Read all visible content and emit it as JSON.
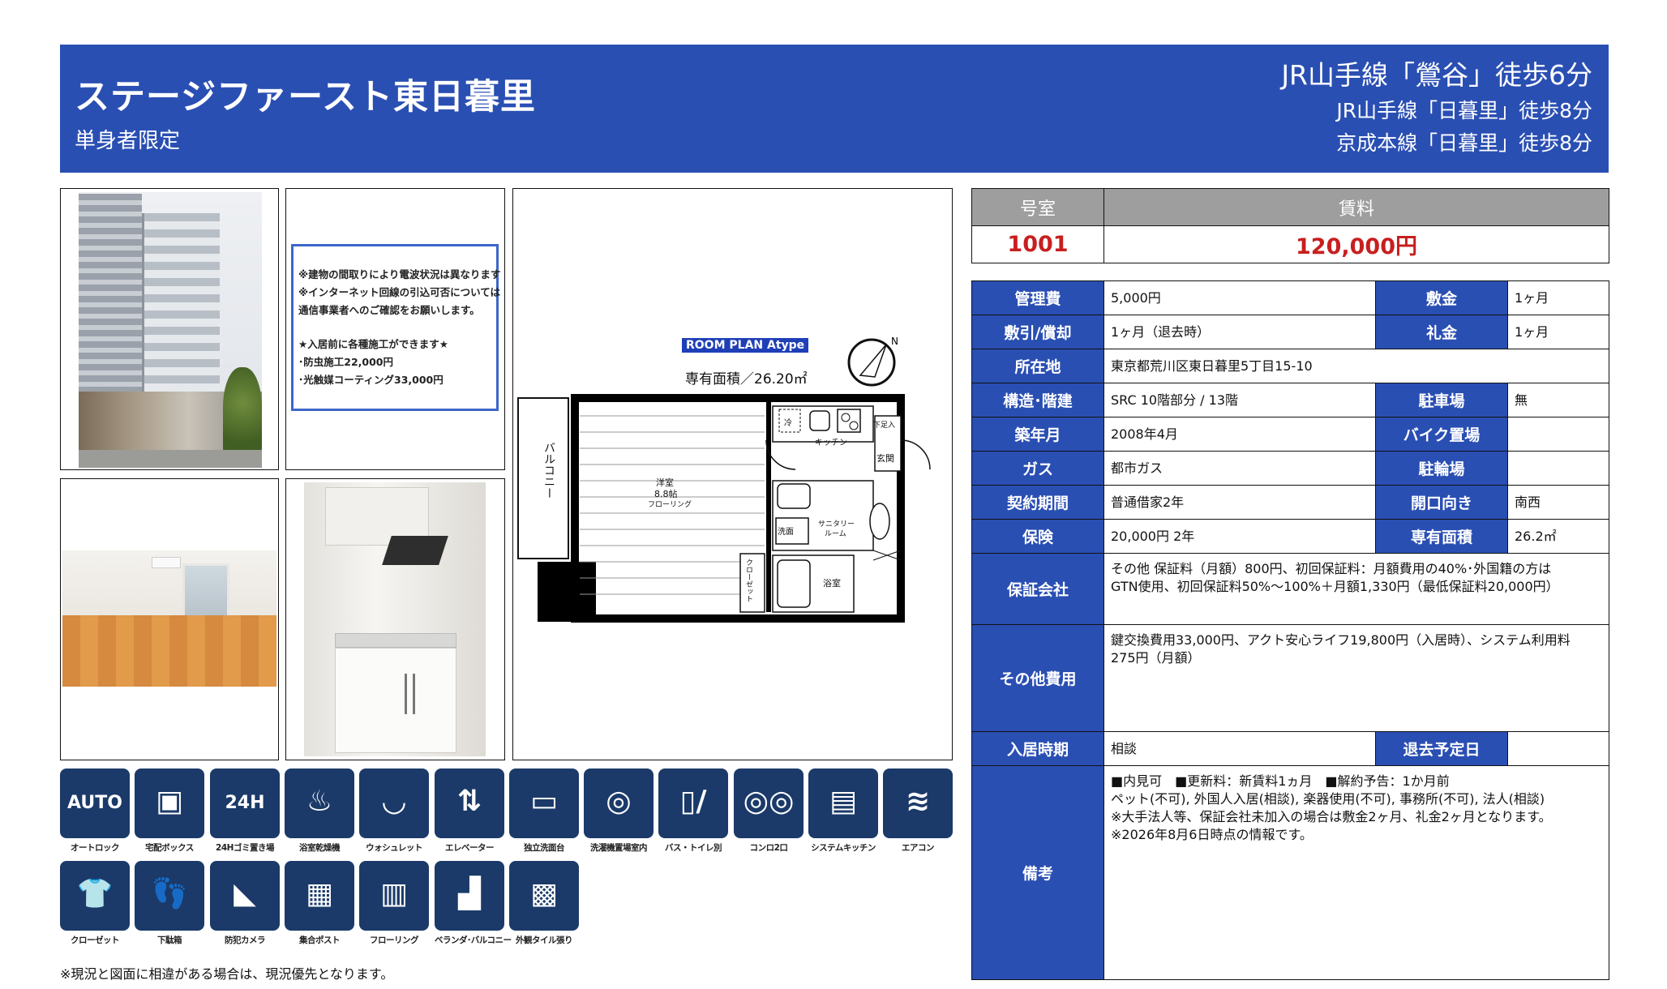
{
  "header": {
    "title": "ステージファースト東日暮里",
    "subtitle": "単身者限定",
    "station_main": "JR山手線「鶯谷」徒歩6分",
    "station_sub1": "JR山手線「日暮里」徒歩8分",
    "station_sub2": "京成本線「日暮里」徒歩8分"
  },
  "notice": {
    "line1": "※建物の間取りにより電波状況は異なります",
    "line2": "※インターネット回線の引込可否については",
    "line3": "通信事業者へのご確認をお願いします。",
    "line4": "★入居前に各種施工ができます★",
    "line5": "･防虫施工22,000円",
    "line6": "･光触媒コーティング33,000円"
  },
  "floor_plan": {
    "tag": "ROOM PLAN  Atype",
    "area": "専有面積／26.20㎡",
    "labels": {
      "balcony": "バルコニー",
      "western_room": "洋室",
      "tatami": "8.8帖",
      "flooring": "フローリング",
      "kitchen": "キッチン",
      "shoebox": "下足入",
      "entrance": "玄関",
      "washroom": "洗面",
      "sanitary1": "サニタリー",
      "sanitary2": "ルーム",
      "bath": "浴室",
      "closet": "クローゼット",
      "fridge": "冷"
    }
  },
  "amenities": [
    {
      "label": "オートロック",
      "icon": "autolock-icon",
      "glyph": "AUTO"
    },
    {
      "label": "宅配ボックス",
      "icon": "delivery-box-icon",
      "glyph": "▣"
    },
    {
      "label": "24Hゴミ置き場",
      "icon": "garbage-24h-icon",
      "glyph": "24H"
    },
    {
      "label": "浴室乾燥機",
      "icon": "bath-dryer-icon",
      "glyph": "♨"
    },
    {
      "label": "ウォシュレット",
      "icon": "washlet-icon",
      "glyph": "◡"
    },
    {
      "label": "エレベーター",
      "icon": "elevator-icon",
      "glyph": "⇅"
    },
    {
      "label": "独立洗面台",
      "icon": "vanity-icon",
      "glyph": "▭"
    },
    {
      "label": "洗濯機置場室内",
      "icon": "washing-machine-icon",
      "glyph": "◎"
    },
    {
      "label": "バス・トイレ別",
      "icon": "bath-toilet-icon",
      "glyph": "▯/"
    },
    {
      "label": "コンロ2口",
      "icon": "stove-icon",
      "glyph": "◎◎"
    },
    {
      "label": "システムキッチン",
      "icon": "system-kitchen-icon",
      "glyph": "▤"
    },
    {
      "label": "エアコン",
      "icon": "aircon-icon",
      "glyph": "≋"
    },
    {
      "label": "クローゼット",
      "icon": "closet-icon",
      "glyph": "👕"
    },
    {
      "label": "下駄箱",
      "icon": "shoe-box-icon",
      "glyph": "👣"
    },
    {
      "label": "防犯カメラ",
      "icon": "security-camera-icon",
      "glyph": "◣"
    },
    {
      "label": "集合ポスト",
      "icon": "mailbox-icon",
      "glyph": "▦"
    },
    {
      "label": "フローリング",
      "icon": "flooring-icon",
      "glyph": "▥"
    },
    {
      "label": "ベランダ･バルコニー",
      "icon": "balcony-icon",
      "glyph": "▟"
    },
    {
      "label": "外観タイル張り",
      "icon": "tile-wall-icon",
      "glyph": "▩"
    }
  ],
  "footnote": "※現況と図面に相違がある場合は、現況優先となります。",
  "rent": {
    "room_label": "号室",
    "rent_label": "賃料",
    "room": "1001",
    "rent": "120,000円"
  },
  "info": {
    "kanrihi_label": "管理費",
    "kanrihi": "5,000円",
    "shikikin_label": "敷金",
    "shikikin": "1ヶ月",
    "shikibiki_label": "敷引/償却",
    "shikibiki": "1ヶ月（退去時）",
    "reikin_label": "礼金",
    "reikin": "1ヶ月",
    "address_label": "所在地",
    "address": "東京都荒川区東日暮里5丁目15-10",
    "structure_label": "構造･階建",
    "structure": "SRC 10階部分 / 13階",
    "parking_label": "駐車場",
    "parking": "無",
    "built_label": "築年月",
    "built": "2008年4月",
    "bike_label": "バイク置場",
    "bike": "",
    "gas_label": "ガス",
    "gas": "都市ガス",
    "bicycle_label": "駐輪場",
    "bicycle": "",
    "contract_label": "契約期間",
    "contract": "普通借家2年",
    "facing_label": "開口向き",
    "facing": "南西",
    "insurance_label": "保険",
    "insurance": "20,000円 2年",
    "area_label": "専有面積",
    "area": "26.2㎡",
    "guarantor_label": "保証会社",
    "guarantor_line1": "その他 保証料（月額）800円、初回保証料：月額費用の40%･外国籍の方は",
    "guarantor_line2": "GTN使用、初回保証料50%～100%＋月額1,330円（最低保証料20,000円）",
    "other_label": "その他費用",
    "other_line1": "鍵交換費用33,000円、アクト安心ライフ19,800円（入居時）、システム利用料",
    "other_line2": "275円（月額）",
    "movein_label": "入居時期",
    "movein": "相談",
    "moveout_label": "退去予定日",
    "moveout": "",
    "remarks_label": "備考",
    "remarks_line1": "■内見可　■更新料：新賃料1ヵ月　■解約予告：1か月前",
    "remarks_line2": "ペット(不可), 外国人入居(相談), 楽器使用(不可), 事務所(不可), 法人(相談)",
    "remarks_line3": "※大手法人等、保証会社未加入の場合は敷金2ヶ月、礼金2ヶ月となります。",
    "remarks_line4": "※2026年8月6日時点の情報です。"
  },
  "colors": {
    "header_blue": "#2a4fb3",
    "label_blue": "#2a4fb3",
    "rent_red": "#c81f1f",
    "rent_header_gray": "#9e9e9e",
    "amenity_navy": "#1b3a69"
  }
}
